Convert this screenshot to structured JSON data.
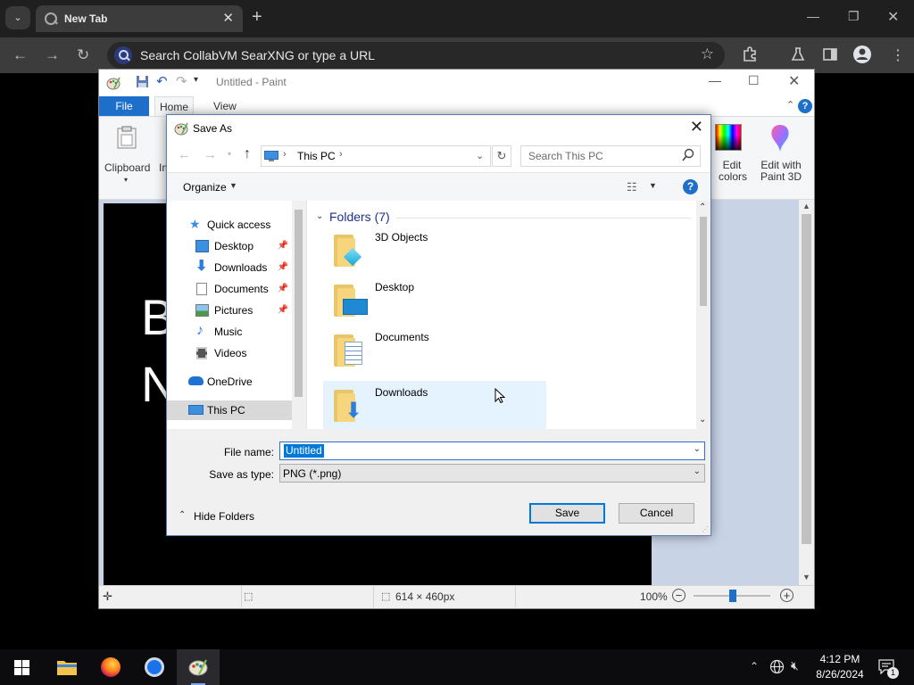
{
  "browser": {
    "tab_title": "New Tab",
    "tab_close": "✕",
    "new_tab": "+",
    "omnibox_text": "Search CollabVM SearXNG or type a URL"
  },
  "paint": {
    "window_title": "Untitled - Paint",
    "tabs": {
      "file": "File",
      "home": "Home",
      "view": "View"
    },
    "clipboard_label": "Clipboard",
    "image_label_partial": "Im",
    "edit_colors": "Edit colors",
    "edit_with_paint3d": "Edit with Paint 3D",
    "canvas_text_line1": "B",
    "canvas_text_line2": "N",
    "status": {
      "dimensions": "614 × 460px",
      "zoom": "100%"
    }
  },
  "dialog": {
    "title": "Save As",
    "breadcrumb_location": "This PC",
    "search_placeholder": "Search This PC",
    "organize_label": "Organize",
    "nav": {
      "quick_access": "Quick access",
      "desktop": "Desktop",
      "downloads": "Downloads",
      "documents": "Documents",
      "pictures": "Pictures",
      "music": "Music",
      "videos": "Videos",
      "onedrive": "OneDrive",
      "this_pc": "This PC"
    },
    "folders_header": "Folders (7)",
    "folders": [
      "3D Objects",
      "Desktop",
      "Documents",
      "Downloads"
    ],
    "file_name_label": "File name:",
    "file_name_value": "Untitled",
    "save_as_type_label": "Save as type:",
    "save_as_type_value": "PNG (*.png)",
    "hide_folders_label": "Hide Folders",
    "save_button": "Save",
    "cancel_button": "Cancel"
  },
  "taskbar": {
    "time": "4:12 PM",
    "date": "8/26/2024",
    "notification_count": "1"
  }
}
